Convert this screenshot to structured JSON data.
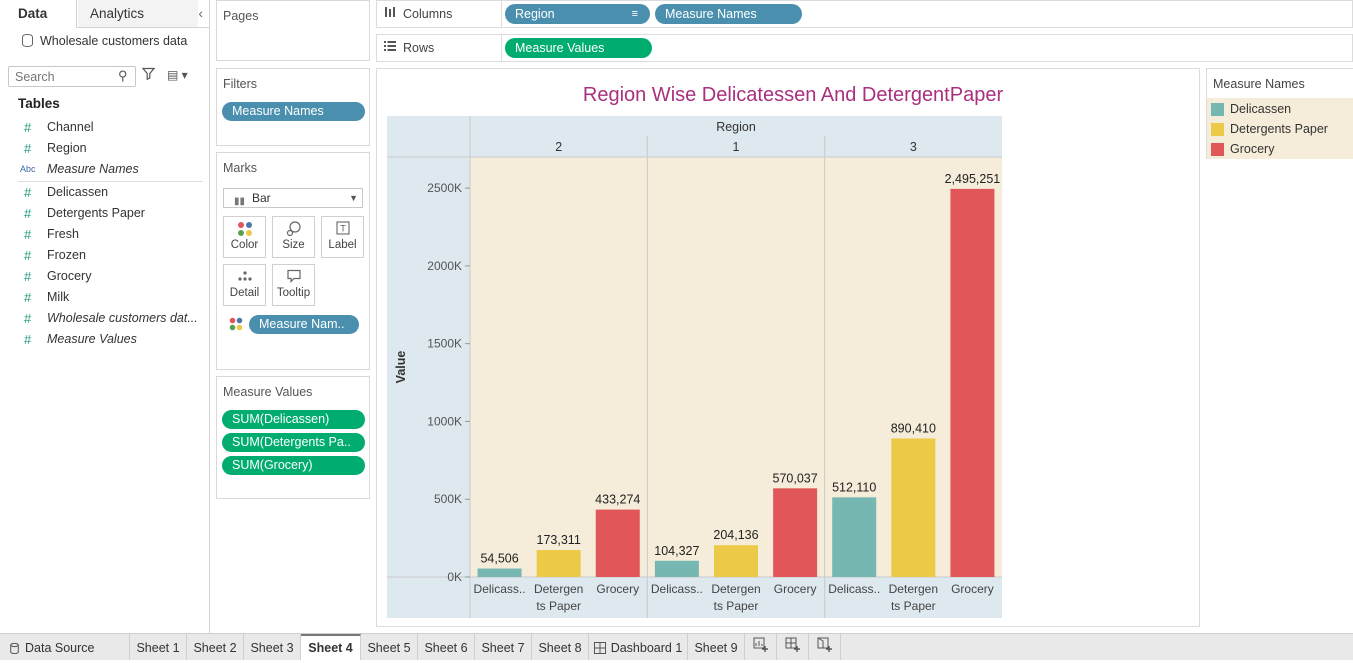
{
  "data_pane": {
    "tab_data": "Data",
    "tab_analytics": "Analytics",
    "collapse_icon": "chevron-left-icon",
    "datasource": "Wholesale customers data",
    "search_placeholder": "Search",
    "tables_heading": "Tables",
    "fields": [
      {
        "icon": "#",
        "name": "Channel",
        "italic": false
      },
      {
        "icon": "#",
        "name": "Region",
        "italic": false
      },
      {
        "icon": "Abc",
        "name": "Measure Names",
        "italic": true
      },
      {
        "icon": "#",
        "name": "Delicassen",
        "italic": false
      },
      {
        "icon": "#",
        "name": "Detergents Paper",
        "italic": false
      },
      {
        "icon": "#",
        "name": "Fresh",
        "italic": false
      },
      {
        "icon": "#",
        "name": "Frozen",
        "italic": false
      },
      {
        "icon": "#",
        "name": "Grocery",
        "italic": false
      },
      {
        "icon": "#",
        "name": "Milk",
        "italic": false
      },
      {
        "icon": "#",
        "name": "Wholesale customers dat...",
        "italic": true
      },
      {
        "icon": "#",
        "name": "Measure Values",
        "italic": true
      }
    ]
  },
  "pages_card": {
    "title": "Pages"
  },
  "filters_card": {
    "title": "Filters",
    "pill": "Measure Names"
  },
  "marks_card": {
    "title": "Marks",
    "mark_type": "Bar",
    "buttons": [
      "Color",
      "Size",
      "Label",
      "Detail",
      "Tooltip"
    ],
    "pill": "Measure Nam.."
  },
  "measure_values_card": {
    "title": "Measure Values",
    "pills": [
      "SUM(Delicassen)",
      "SUM(Detergents Pa..",
      "SUM(Grocery)"
    ]
  },
  "shelves": {
    "columns_label": "Columns",
    "columns_pills": [
      "Region",
      "Measure Names"
    ],
    "rows_label": "Rows",
    "rows_pills": [
      "Measure Values"
    ]
  },
  "viz": {
    "title": "Region Wise Delicatessen And DetergentPaper"
  },
  "legend": {
    "title": "Measure Names",
    "items": [
      {
        "label": "Delicassen",
        "color": "#76b7b2"
      },
      {
        "label": "Detergents Paper",
        "color": "#edc948"
      },
      {
        "label": "Grocery",
        "color": "#e15759"
      }
    ]
  },
  "chart_data": {
    "type": "bar",
    "title": "Region Wise Delicatessen And DetergentPaper",
    "column_header": "Region",
    "ylabel": "Value",
    "ylim": [
      0,
      2700000
    ],
    "yticks": [
      0,
      500000,
      1000000,
      1500000,
      2000000,
      2500000
    ],
    "ytick_labels": [
      "0K",
      "500K",
      "1000K",
      "1500K",
      "2000K",
      "2500K"
    ],
    "regions": [
      "2",
      "1",
      "3"
    ],
    "measure_labels": [
      [
        "Delicass..",
        ""
      ],
      [
        "Detergen",
        "ts Paper"
      ],
      [
        "Grocery",
        ""
      ]
    ],
    "series": [
      {
        "name": "Delicassen",
        "color": "#76b7b2",
        "values": [
          54506,
          104327,
          512110
        ],
        "labels": [
          "54,506",
          "104,327",
          "512,110"
        ]
      },
      {
        "name": "Detergents Paper",
        "color": "#edc948",
        "values": [
          173311,
          204136,
          890410
        ],
        "labels": [
          "173,311",
          "204,136",
          "890,410"
        ]
      },
      {
        "name": "Grocery",
        "color": "#e15759",
        "values": [
          433274,
          570037,
          2495251
        ],
        "labels": [
          "433,274",
          "570,037",
          "2,495,251"
        ]
      }
    ],
    "colors": {
      "header_bg": "#dde9ef",
      "pane_bg": "#f5ecda"
    }
  },
  "bottom_tabs": [
    {
      "label": "Data Source",
      "icon": "database-icon"
    },
    {
      "label": "Sheet 1"
    },
    {
      "label": "Sheet 2"
    },
    {
      "label": "Sheet 3"
    },
    {
      "label": "Sheet 4",
      "active": true
    },
    {
      "label": "Sheet 5"
    },
    {
      "label": "Sheet 6"
    },
    {
      "label": "Sheet 7"
    },
    {
      "label": "Sheet 8"
    },
    {
      "label": "Dashboard 1",
      "icon": "dashboard-icon"
    },
    {
      "label": "Sheet 9"
    },
    {
      "label": "",
      "icon": "new-worksheet-icon"
    },
    {
      "label": "",
      "icon": "new-dashboard-icon"
    },
    {
      "label": "",
      "icon": "new-story-icon"
    }
  ]
}
